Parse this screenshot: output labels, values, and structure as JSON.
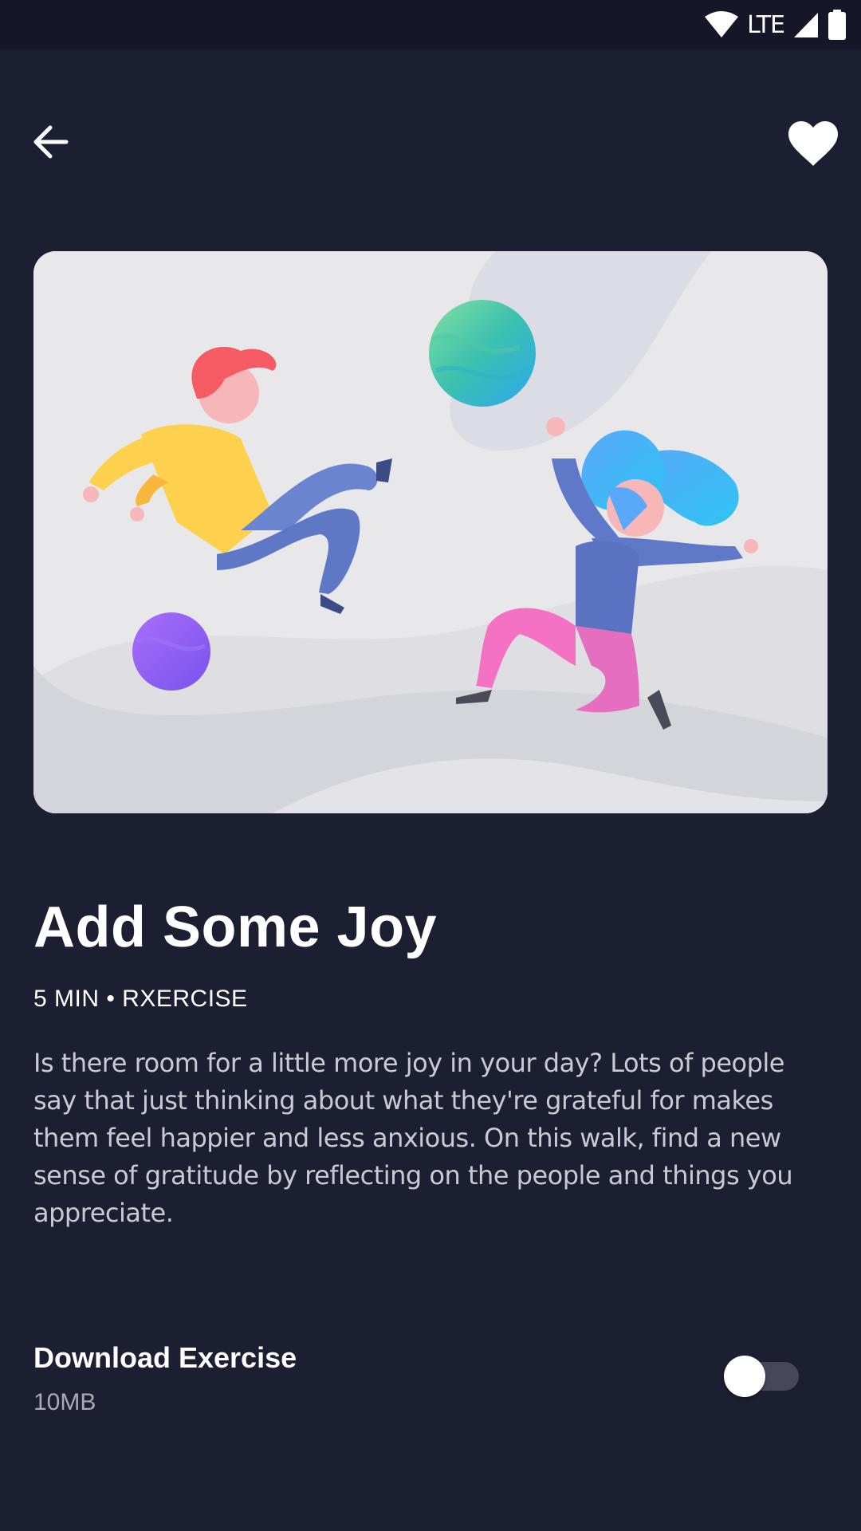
{
  "status_bar": {
    "network": "LTE",
    "icons": [
      "wifi-icon",
      "cellular-signal-icon",
      "battery-icon"
    ]
  },
  "top_bar": {
    "back_icon": "arrow-left-icon",
    "favorite_icon": "heart-icon"
  },
  "hero": {
    "illustration": "people-playing-with-balls-illustration"
  },
  "exercise": {
    "title": "Add Some Joy",
    "meta": "5 MIN • RXERCISE",
    "description": "Is there room for a little more joy in your day? Lots of people say that just thinking about what they're grateful for makes them feel happier and less anxious. On this walk, find a new sense of gratitude by reflecting on the people and things you appreciate."
  },
  "download": {
    "title": "Download Exercise",
    "size": "10MB",
    "enabled": false
  },
  "colors": {
    "background": "#1c1e31",
    "status_bar": "#151728",
    "text_primary": "#ffffff",
    "text_secondary": "#c9cad3",
    "toggle_track": "#46485a"
  }
}
